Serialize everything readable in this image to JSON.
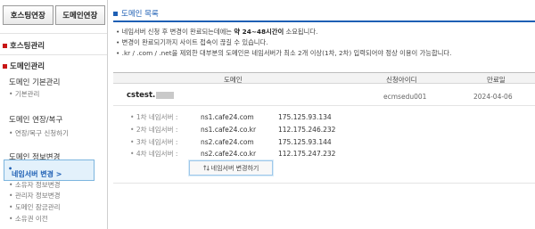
{
  "sidebar": {
    "buttons": [
      "호스팅연장",
      "도메인연장"
    ],
    "sections": [
      {
        "label": "호스팅관리"
      },
      {
        "label": "도메인관리"
      }
    ],
    "groups": [
      {
        "label": "도메인 기본관리",
        "items": [
          "기본관리"
        ]
      },
      {
        "label": "도메인 연장/복구",
        "items": [
          "연장/복구 신청하기"
        ]
      },
      {
        "label": "도메인 정보변경",
        "items": [
          "네임서버 변경 >",
          "소유자 정보변경",
          "관리자 정보변경",
          "도메인 잠금관리",
          "소유권 이전"
        ]
      }
    ],
    "active_item": "네임서버 변경 >"
  },
  "main": {
    "title": "도메인 목록",
    "notes": [
      {
        "pre": "네임서버 신청 후 변경이 완료되는데에는 ",
        "bold": "약 24~48시간이",
        "post": " 소요됩니다."
      },
      {
        "pre": "변경이 완료되기까지 사이트 접속이 끊길 수 있습니다.",
        "bold": "",
        "post": ""
      },
      {
        "pre": ".kr / .com / .net을 제외한 대부분의 도메인은 네임서버가 최소 2개 이상(1차, 2차) 입력되어야 정상 이용이 가능합니다.",
        "bold": "",
        "post": ""
      }
    ],
    "table_headers": {
      "domain": "도메인",
      "applicant_id": "신청아이디",
      "expiry": "만료일"
    },
    "row": {
      "domain": "cstest.",
      "applicant_id": "ecmsedu001",
      "expiry": "2024-04-06"
    },
    "nameservers": [
      {
        "label": "1차 네임서버 :",
        "host": "ns1.cafe24.com",
        "ip": "175.125.93.134"
      },
      {
        "label": "2차 네임서버 :",
        "host": "ns1.cafe24.co.kr",
        "ip": "112.175.246.232"
      },
      {
        "label": "3차 네임서버 :",
        "host": "ns2.cafe24.com",
        "ip": "175.125.93.144"
      },
      {
        "label": "4차 네임서버 :",
        "host": "ns2.cafe24.co.kr",
        "ip": "112.175.247.232"
      }
    ],
    "change_button": "네임서버 변경하기"
  },
  "colors": {
    "accent": "#1e5fb4",
    "section_marker": "#c81616",
    "active_bg": "#e3f1fb"
  }
}
